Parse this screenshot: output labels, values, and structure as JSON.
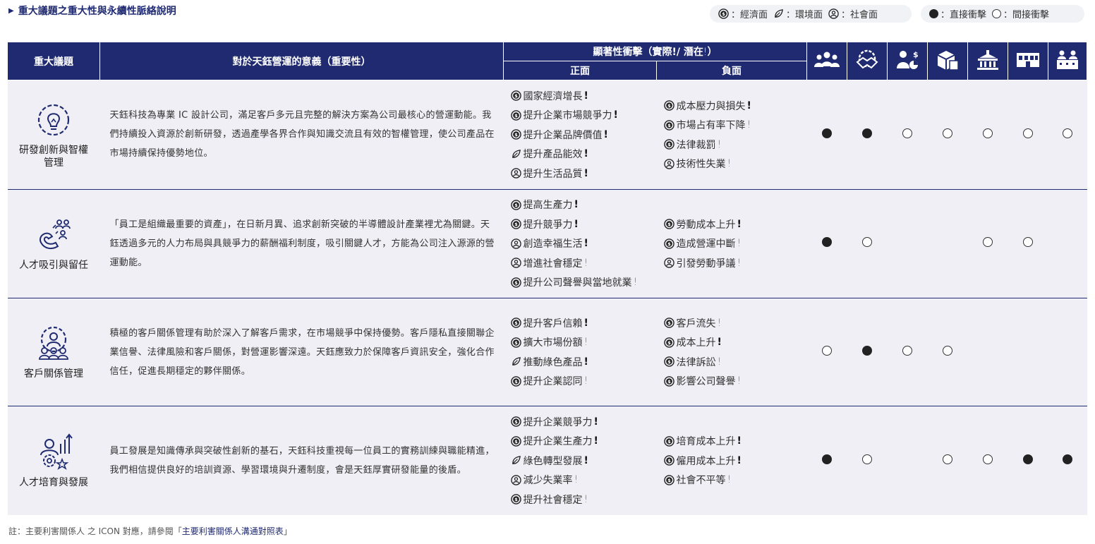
{
  "header": {
    "title": "重大議題之重大性與永續性脈絡說明",
    "legend_categories": [
      {
        "icon": "dollar-circle-icon",
        "label": "：經濟面"
      },
      {
        "icon": "leaf-icon",
        "label": "：環境面"
      },
      {
        "icon": "person-circle-icon",
        "label": "：社會面"
      }
    ],
    "legend_impacts": [
      {
        "icon": "filled-dot-icon",
        "label": "：直接衝擊"
      },
      {
        "icon": "hollow-dot-icon",
        "label": "：間接衝擊"
      }
    ]
  },
  "table": {
    "col_issue": "重大議題",
    "col_meaning": "對於天鈺營運的意義（重要性）",
    "col_impact": "顯著性衝擊（實際",
    "col_impact_mid": "/ 潛在",
    "col_impact_end": "）",
    "col_positive": "正面",
    "col_negative": "負面",
    "stakeholders": [
      "employees-icon",
      "customers-handshake-icon",
      "investors-icon",
      "suppliers-icon",
      "government-icon",
      "community-icon",
      "peers-icon"
    ],
    "rows": [
      {
        "issue_icon": "lightbulb-gear-icon",
        "issue": "研發創新與智權管理",
        "meaning": "天鈺科技為專業 IC 設計公司，滿足客戶多元且完整的解決方案為公司最核心的營運動能。我們持續投入資源於創新研發，透過產學各界合作與知識交流且有效的智權管理，使公司產品在市場持續保持優勢地位。",
        "positive": [
          {
            "cat": "econ",
            "text": "國家經濟增長",
            "type": "actual"
          },
          {
            "cat": "econ",
            "text": "提升企業市場競爭力",
            "type": "actual"
          },
          {
            "cat": "econ",
            "text": "提升企業品牌價值",
            "type": "actual"
          },
          {
            "cat": "env",
            "text": "提升產品能效",
            "type": "actual"
          },
          {
            "cat": "soc",
            "text": "提升生活品質",
            "type": "actual"
          }
        ],
        "negative": [
          {
            "cat": "econ",
            "text": "成本壓力與損失",
            "type": "actual"
          },
          {
            "cat": "econ",
            "text": "市場占有率下降",
            "type": "potential"
          },
          {
            "cat": "econ",
            "text": "法律裁罰",
            "type": "potential"
          },
          {
            "cat": "soc",
            "text": "技術性失業",
            "type": "potential"
          }
        ],
        "dots": [
          "direct",
          "direct",
          "indirect",
          "indirect",
          "indirect",
          "indirect",
          "indirect"
        ]
      },
      {
        "issue_icon": "magnet-people-icon",
        "issue": "人才吸引與留任",
        "meaning": "「員工是組織最重要的資產」，在日新月異、追求創新突破的半導體設計產業裡尤為關鍵。天鈺透過多元的人力布局與具競爭力的薪酬福利制度，吸引關鍵人才，方能為公司注入源源的營運動能。",
        "positive": [
          {
            "cat": "econ",
            "text": "提高生產力",
            "type": "actual"
          },
          {
            "cat": "econ",
            "text": "提升競爭力",
            "type": "actual"
          },
          {
            "cat": "soc",
            "text": "創造幸福生活",
            "type": "actual"
          },
          {
            "cat": "soc",
            "text": "增進社會穩定",
            "type": "potential"
          },
          {
            "cat": "econ",
            "text": "提升公司聲譽與當地就業",
            "type": "potential"
          }
        ],
        "negative": [
          {
            "cat": "econ",
            "text": "勞動成本上升",
            "type": "actual"
          },
          {
            "cat": "econ",
            "text": "造成營運中斷",
            "type": "potential"
          },
          {
            "cat": "soc",
            "text": "引發勞動爭議",
            "type": "potential"
          }
        ],
        "dots": [
          "direct",
          "indirect",
          "",
          "",
          "indirect",
          "indirect",
          ""
        ]
      },
      {
        "issue_icon": "customer-gear-icon",
        "issue": "客戶關係管理",
        "meaning": "積極的客戶關係管理有助於深入了解客戶需求，在市場競爭中保持優勢。客戶隱私直接關聯企業信譽、法律風險和客戶關係，對營運影響深遠。天鈺應致力於保障客戶資訊安全，強化合作信任，促進長期穩定的夥伴關係。",
        "positive": [
          {
            "cat": "econ",
            "text": "提升客戶信賴",
            "type": "actual"
          },
          {
            "cat": "econ",
            "text": "擴大市場份額",
            "type": "potential"
          },
          {
            "cat": "env",
            "text": "推動綠色產品",
            "type": "actual"
          },
          {
            "cat": "econ",
            "text": "提升企業認同",
            "type": "potential"
          }
        ],
        "negative": [
          {
            "cat": "econ",
            "text": "客戶流失",
            "type": "potential"
          },
          {
            "cat": "econ",
            "text": "成本上升",
            "type": "actual"
          },
          {
            "cat": "econ",
            "text": "法律訴訟",
            "type": "potential"
          },
          {
            "cat": "econ",
            "text": "影響公司聲譽",
            "type": "potential"
          }
        ],
        "dots": [
          "indirect",
          "direct",
          "indirect",
          "indirect",
          "",
          "",
          ""
        ]
      },
      {
        "issue_icon": "people-growth-icon",
        "issue": "人才培育與發展",
        "meaning": "員工發展是知識傳承與突破性創新的基石，天鈺科技重視每一位員工的實務訓練與職能精進，我們相信提供良好的培訓資源、學習環境與升遷制度，會是天鈺厚實研發能量的後盾。",
        "positive": [
          {
            "cat": "econ",
            "text": "提升企業競爭力",
            "type": "actual"
          },
          {
            "cat": "econ",
            "text": "提升企業生產力",
            "type": "actual"
          },
          {
            "cat": "env",
            "text": "綠色轉型發展",
            "type": "actual"
          },
          {
            "cat": "soc",
            "text": "減少失業率",
            "type": "potential"
          },
          {
            "cat": "econ",
            "text": "提升社會穩定",
            "type": "potential"
          }
        ],
        "negative": [
          {
            "cat": "econ",
            "text": "培育成本上升",
            "type": "actual"
          },
          {
            "cat": "econ",
            "text": "僱用成本上升",
            "type": "actual"
          },
          {
            "cat": "econ",
            "text": "社會不平等",
            "type": "potential"
          }
        ],
        "dots": [
          "direct",
          "indirect",
          "",
          "indirect",
          "indirect",
          "direct",
          "direct"
        ]
      }
    ]
  },
  "footnote": {
    "prefix": "註：主要利害關係人 之 ICON 對應，請參閱「",
    "link": "主要利害關係人溝通對照表",
    "suffix": "」"
  }
}
